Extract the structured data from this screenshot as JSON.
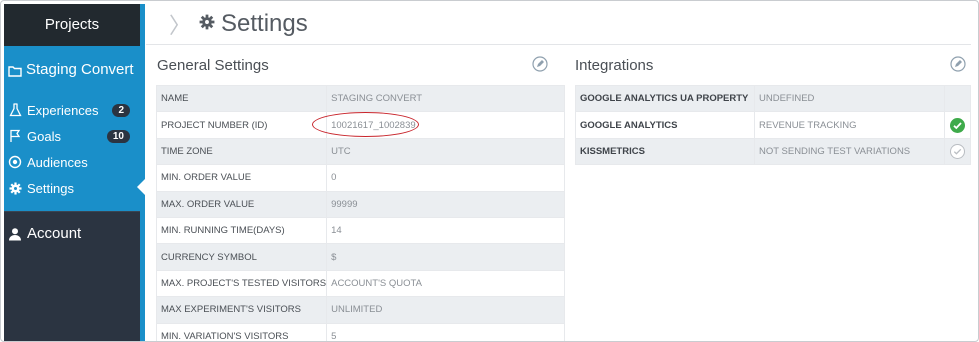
{
  "sidebar": {
    "projects_label": "Projects",
    "project_name": "Staging Convert",
    "items": [
      {
        "label": "Experiences",
        "icon": "flask-icon",
        "badge": "2"
      },
      {
        "label": "Goals",
        "icon": "flag-icon",
        "badge": "10"
      },
      {
        "label": "Audiences",
        "icon": "target-icon",
        "badge": ""
      },
      {
        "label": "Settings",
        "icon": "gear-icon",
        "badge": ""
      }
    ],
    "account_label": "Account"
  },
  "header": {
    "title": "Settings"
  },
  "general_settings": {
    "title": "General Settings",
    "rows": [
      {
        "key": "NAME",
        "value": "STAGING CONVERT"
      },
      {
        "key": "PROJECT NUMBER (ID)",
        "value": "10021617_1002839"
      },
      {
        "key": "TIME ZONE",
        "value": "UTC"
      },
      {
        "key": "MIN. ORDER VALUE",
        "value": "0"
      },
      {
        "key": "MAX. ORDER VALUE",
        "value": "99999"
      },
      {
        "key": "MIN. RUNNING TIME(DAYS)",
        "value": "14"
      },
      {
        "key": "CURRENCY SYMBOL",
        "value": "$"
      },
      {
        "key": "MAX. PROJECT'S TESTED VISITORS",
        "value": "ACCOUNT'S QUOTA"
      },
      {
        "key": "MAX EXPERIMENT'S VISITORS",
        "value": "UNLIMITED"
      },
      {
        "key": "MIN. VARIATION'S VISITORS",
        "value": "5"
      }
    ]
  },
  "integrations": {
    "title": "Integrations",
    "rows": [
      {
        "key": "GOOGLE ANALYTICS UA PROPERTY",
        "value": "UNDEFINED",
        "status": "none"
      },
      {
        "key": "GOOGLE ANALYTICS",
        "value": "REVENUE TRACKING",
        "status": "enabled"
      },
      {
        "key": "KISSMETRICS",
        "value": "NOT SENDING TEST VARIATIONS",
        "status": "disabled"
      }
    ]
  },
  "colors": {
    "sidebar_bg": "#2b3441",
    "accent": "#1a8fc9",
    "highlight_ring": "#c8252c",
    "check_green": "#3eaa4a"
  }
}
